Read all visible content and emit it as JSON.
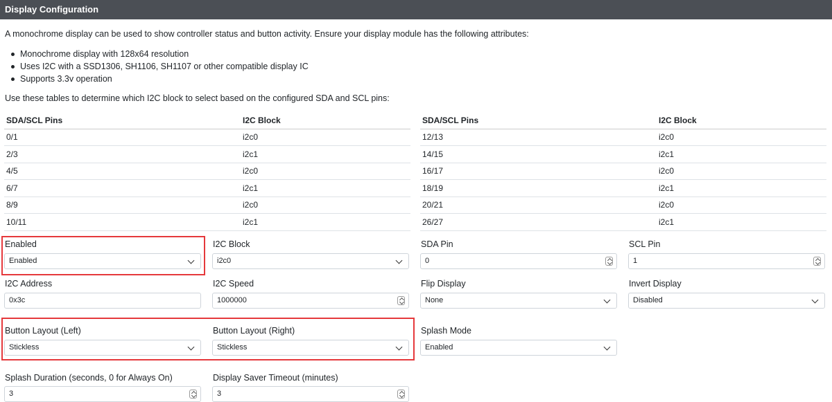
{
  "header": {
    "title": "Display Configuration"
  },
  "intro": "A monochrome display can be used to show controller status and button activity. Ensure your display module has the following attributes:",
  "bullets": [
    "Monochrome display with 128x64 resolution",
    "Uses I2C with a SSD1306, SH1106, SH1107 or other compatible display IC",
    "Supports 3.3v operation"
  ],
  "tables_intro": "Use these tables to determine which I2C block to select based on the configured SDA and SCL pins:",
  "tables": {
    "headers": [
      "SDA/SCL Pins",
      "I2C Block"
    ],
    "left": [
      [
        "0/1",
        "i2c0"
      ],
      [
        "2/3",
        "i2c1"
      ],
      [
        "4/5",
        "i2c0"
      ],
      [
        "6/7",
        "i2c1"
      ],
      [
        "8/9",
        "i2c0"
      ],
      [
        "10/11",
        "i2c1"
      ]
    ],
    "right": [
      [
        "12/13",
        "i2c0"
      ],
      [
        "14/15",
        "i2c1"
      ],
      [
        "16/17",
        "i2c0"
      ],
      [
        "18/19",
        "i2c1"
      ],
      [
        "20/21",
        "i2c0"
      ],
      [
        "26/27",
        "i2c1"
      ]
    ]
  },
  "fields": {
    "enabled": {
      "label": "Enabled",
      "value": "Enabled"
    },
    "i2c_block": {
      "label": "I2C Block",
      "value": "i2c0"
    },
    "sda_pin": {
      "label": "SDA Pin",
      "value": "0"
    },
    "scl_pin": {
      "label": "SCL Pin",
      "value": "1"
    },
    "i2c_address": {
      "label": "I2C Address",
      "value": "0x3c"
    },
    "i2c_speed": {
      "label": "I2C Speed",
      "value": "1000000"
    },
    "flip_display": {
      "label": "Flip Display",
      "value": "None"
    },
    "invert_display": {
      "label": "Invert Display",
      "value": "Disabled"
    },
    "button_layout_left": {
      "label": "Button Layout (Left)",
      "value": "Stickless"
    },
    "button_layout_right": {
      "label": "Button Layout (Right)",
      "value": "Stickless"
    },
    "splash_mode": {
      "label": "Splash Mode",
      "value": "Enabled"
    },
    "splash_duration": {
      "label": "Splash Duration (seconds, 0 for Always On)",
      "value": "3"
    },
    "display_saver_timeout": {
      "label": "Display Saver Timeout (minutes)",
      "value": "3"
    }
  },
  "colors": {
    "header_bg": "#4b4f55",
    "highlight": "#e5383b"
  }
}
